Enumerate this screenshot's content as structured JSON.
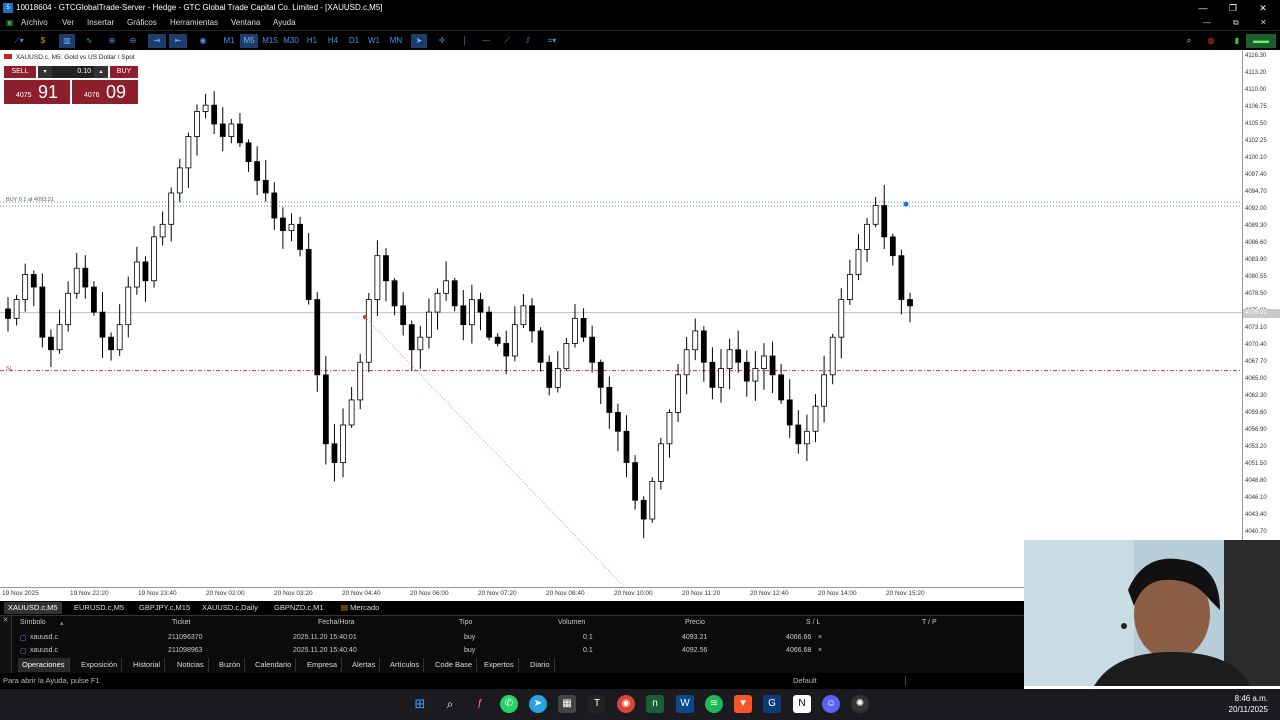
{
  "titlebar": {
    "title": "10018604 - GTCGlobalTrade-Server - Hedge - GTC Global Trade Capital Co. Limited - [XAUUSD.c,M5]"
  },
  "menu": [
    "Archivo",
    "Ver",
    "Insertar",
    "Gráficos",
    "Herramientas",
    "Ventana",
    "Ayuda"
  ],
  "timeframes": [
    "M1",
    "M5",
    "M15",
    "M30",
    "H1",
    "H4",
    "D1",
    "W1",
    "MN"
  ],
  "active_timeframe": "M5",
  "chart": {
    "symbol_title": "XAUUSD.c, M5:  Gold vs US Dollar / Spot",
    "sell_label": "SELL",
    "buy_label": "BUY",
    "volume": "0.10",
    "sell_price_small": "4075",
    "sell_price_big": "91",
    "buy_price_small": "4076",
    "buy_price_big": "09",
    "buy_line_label": "BUY 0.1 at 4093.21",
    "sl_label": "SL",
    "current_price_label": "4075.91"
  },
  "chart_data": {
    "type": "candlestick",
    "y_ticks": [
      "4116.30",
      "4113.20",
      "4110.00",
      "4106.75",
      "4105.50",
      "4102.25",
      "4100.10",
      "4097.40",
      "4094.70",
      "4092.00",
      "4089.30",
      "4086.60",
      "4083.90",
      "4080.55",
      "4078.50",
      "4075.91",
      "4073.10",
      "4070.40",
      "4067.70",
      "4065.00",
      "4062.30",
      "4059.60",
      "4056.90",
      "4053.20",
      "4051.50",
      "4048.80",
      "4046.10",
      "4043.40",
      "4040.70"
    ],
    "x_ticks": [
      "19 Nov 2025",
      "19 Nov 22:20",
      "19 Nov 23:40",
      "20 Nov 02:00",
      "20 Nov 03:20",
      "20 Nov 04:40",
      "20 Nov 06:00",
      "20 Nov 07:20",
      "20 Nov 08:40",
      "20 Nov 10:00",
      "20 Nov 11:20",
      "20 Nov 12:40",
      "20 Nov 14:00",
      "20 Nov 15:20"
    ],
    "closes": [
      4075,
      4078,
      4082,
      4080,
      4072,
      4070,
      4074,
      4079,
      4083,
      4080,
      4076,
      4072,
      4070,
      4074,
      4080,
      4084,
      4081,
      4088,
      4090,
      4095,
      4099,
      4104,
      4108,
      4109,
      4106,
      4104,
      4106,
      4103,
      4100,
      4097,
      4095,
      4091,
      4089,
      4090,
      4086,
      4078,
      4066,
      4055,
      4052,
      4058,
      4062,
      4068,
      4078,
      4085,
      4081,
      4077,
      4074,
      4070,
      4072,
      4076,
      4079,
      4081,
      4077,
      4074,
      4078,
      4076,
      4072,
      4071,
      4069,
      4074,
      4077,
      4073,
      4068,
      4064,
      4067,
      4071,
      4075,
      4072,
      4068,
      4064,
      4060,
      4057,
      4052,
      4046,
      4043,
      4049,
      4055,
      4060,
      4066,
      4070,
      4073,
      4068,
      4064,
      4067,
      4070,
      4068,
      4065,
      4067,
      4069,
      4066,
      4062,
      4058,
      4055,
      4057,
      4061,
      4066,
      4072,
      4078,
      4082,
      4086,
      4090,
      4093,
      4088,
      4085,
      4078,
      4077
    ],
    "ylim": [
      4039.5,
      4117.0
    ],
    "buy_entry": 4093.21,
    "stop_loss": 4066.66,
    "current_price": 4075.91
  },
  "symbol_tabs": [
    "XAUUSD.c,M5",
    "EURUSD.c,M5",
    "GBPJPY.c,M15",
    "XAUUSD.c,Daily",
    "GBPNZD.c,M1",
    "Mercado"
  ],
  "positions": {
    "headers": [
      "Símbolo",
      "Ticket",
      "Fecha/Hora",
      "Tipo",
      "Volumen",
      "Precio",
      "S / L",
      "T / P"
    ],
    "rows": [
      [
        "xauusd.c",
        "211096370",
        "2025.11.20 15:40:01",
        "buy",
        "0.1",
        "4093.21",
        "4066.66",
        "×"
      ],
      [
        "xauusd.c",
        "211098963",
        "2025.11.20 15:40:40",
        "buy",
        "0.1",
        "4092.56",
        "4066.68",
        "×"
      ]
    ]
  },
  "toolbox_tabs": [
    "Operaciones",
    "Exposición",
    "Historial",
    "Noticias",
    "Buzón",
    "Calendario",
    "Empresa",
    "Alertas",
    "Artículos",
    "Code Base",
    "Expertos",
    "Diario"
  ],
  "status": {
    "help": "Para abrir la Ayuda, pulse F1",
    "profile": "Default"
  },
  "clock": {
    "time": "8:46 a.m.",
    "date": "20/11/2025"
  }
}
